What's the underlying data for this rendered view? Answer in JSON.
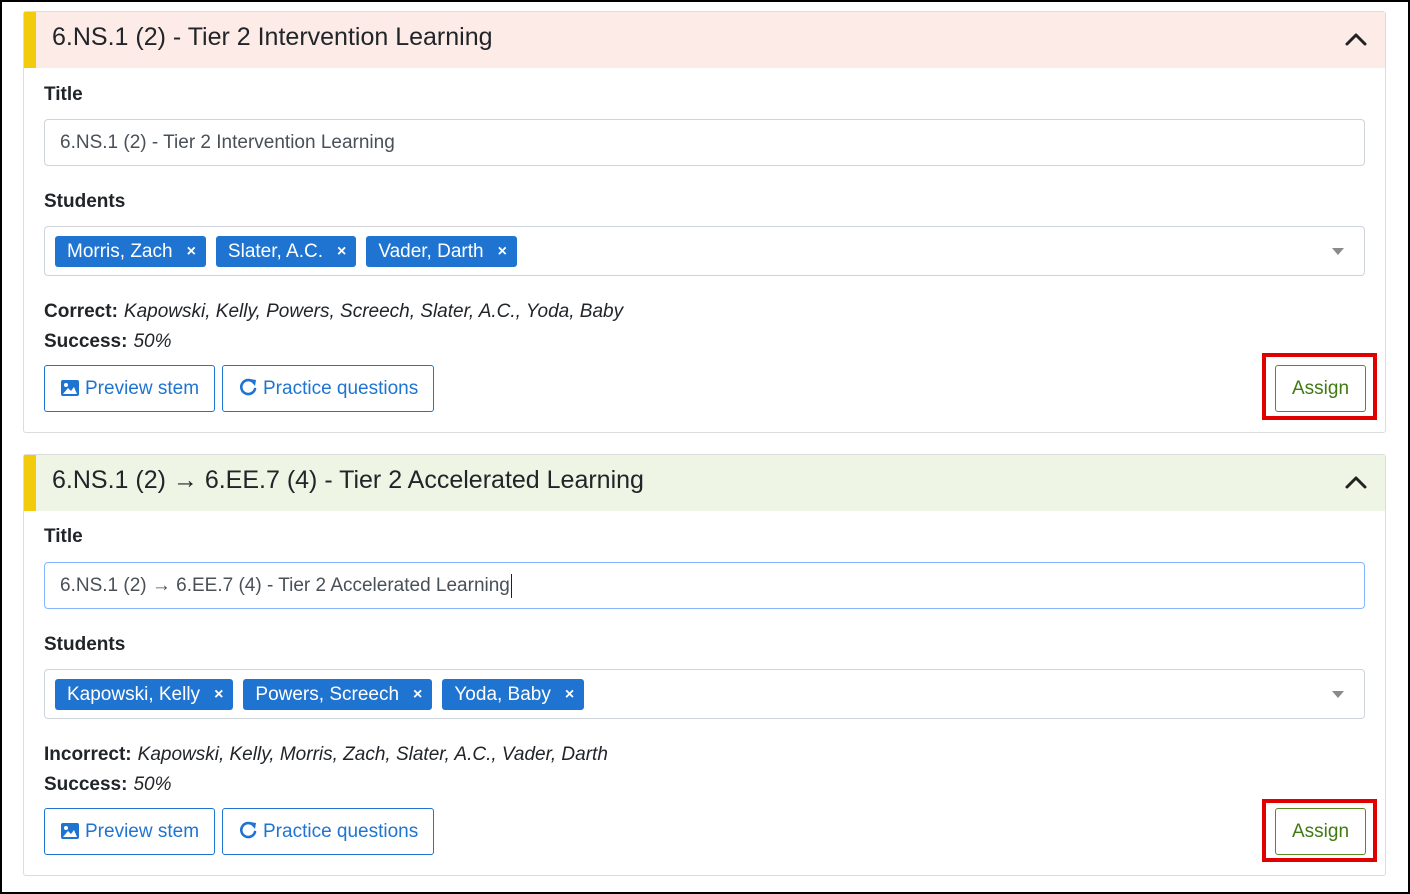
{
  "cards": [
    {
      "header_title": "6.NS.1 (2) - Tier 2 Intervention Learning",
      "title_label": "Title",
      "title_value": "6.NS.1 (2) - Tier 2 Intervention Learning",
      "students_label": "Students",
      "students": [
        "Morris, Zach",
        "Slater, A.C.",
        "Vader, Darth"
      ],
      "result_label": "Correct:",
      "result_value": "Kapowski, Kelly, Powers, Screech, Slater, A.C., Yoda, Baby",
      "success_label": "Success:",
      "success_value": "50%",
      "preview_button": "Preview stem",
      "practice_button": "Practice questions",
      "assign_button": "Assign"
    },
    {
      "header_title": "6.NS.1 (2) → 6.EE.7 (4) - Tier 2 Accelerated Learning",
      "title_label": "Title",
      "title_value": "6.NS.1 (2) → 6.EE.7 (4) - Tier 2 Accelerated Learning",
      "students_label": "Students",
      "students": [
        "Kapowski, Kelly",
        "Powers, Screech",
        "Yoda, Baby"
      ],
      "result_label": "Incorrect:",
      "result_value": "Kapowski, Kelly, Morris, Zach, Slater, A.C., Vader, Darth",
      "success_label": "Success:",
      "success_value": "50%",
      "preview_button": "Preview stem",
      "practice_button": "Practice questions",
      "assign_button": "Assign"
    }
  ],
  "colors": {
    "accent": "#1f74d1",
    "intervention_header": "#fdebe8",
    "accelerated_header": "#eef5e4",
    "header_stripe": "#f2cc0c",
    "assign_text": "#3f7a12",
    "highlight": "#e00000"
  },
  "icons": {
    "collapse": "chevron-up-icon",
    "preview": "image-icon",
    "practice": "refresh-icon",
    "remove_tag": "close-icon",
    "dropdown": "caret-down-icon"
  }
}
